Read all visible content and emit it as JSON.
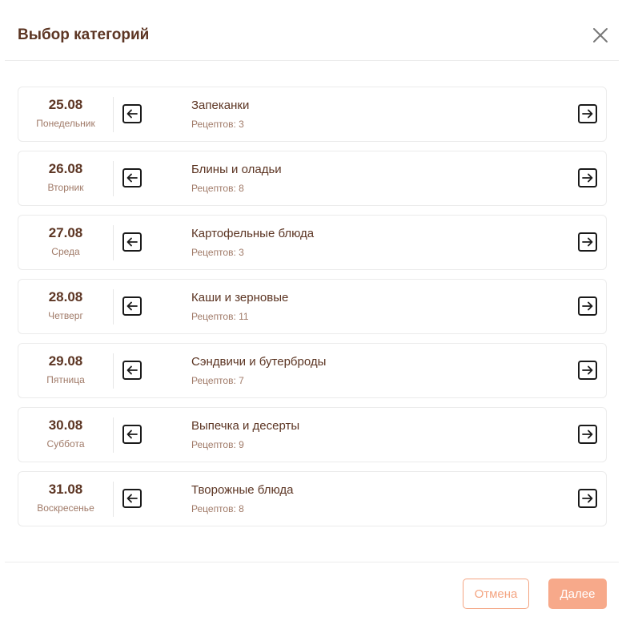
{
  "dialog": {
    "title": "Выбор категорий",
    "close_icon": "close-icon"
  },
  "rows": [
    {
      "date": "25.08",
      "weekday": "Понедельник",
      "category": "Запеканки",
      "recipes": "Рецептов: 3"
    },
    {
      "date": "26.08",
      "weekday": "Вторник",
      "category": "Блины и оладьи",
      "recipes": "Рецептов: 8"
    },
    {
      "date": "27.08",
      "weekday": "Среда",
      "category": "Картофельные блюда",
      "recipes": "Рецептов: 3"
    },
    {
      "date": "28.08",
      "weekday": "Четверг",
      "category": "Каши и зерновые",
      "recipes": "Рецептов: 11"
    },
    {
      "date": "29.08",
      "weekday": "Пятница",
      "category": "Сэндвичи и бутерброды",
      "recipes": "Рецептов: 7"
    },
    {
      "date": "30.08",
      "weekday": "Суббота",
      "category": "Выпечка и десерты",
      "recipes": "Рецептов: 9"
    },
    {
      "date": "31.08",
      "weekday": "Воскресенье",
      "category": "Творожные блюда",
      "recipes": "Рецептов: 8"
    }
  ],
  "icons": {
    "prev": "arrow-left-square-icon",
    "next": "arrow-right-square-icon"
  },
  "footer": {
    "cancel_label": "Отмена",
    "next_label": "Далее"
  },
  "colors": {
    "title": "#5c3523",
    "muted": "#a07a68",
    "accent": "#f4a582",
    "accent_fill": "#f7a98a"
  }
}
